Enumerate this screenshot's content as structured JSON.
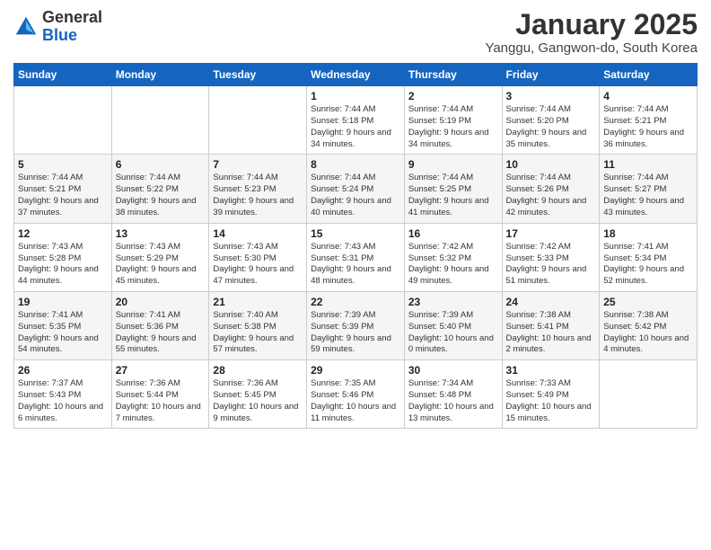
{
  "header": {
    "logo_general": "General",
    "logo_blue": "Blue",
    "month": "January 2025",
    "location": "Yanggu, Gangwon-do, South Korea"
  },
  "weekdays": [
    "Sunday",
    "Monday",
    "Tuesday",
    "Wednesday",
    "Thursday",
    "Friday",
    "Saturday"
  ],
  "weeks": [
    [
      {
        "day": "",
        "detail": ""
      },
      {
        "day": "",
        "detail": ""
      },
      {
        "day": "",
        "detail": ""
      },
      {
        "day": "1",
        "detail": "Sunrise: 7:44 AM\nSunset: 5:18 PM\nDaylight: 9 hours and 34 minutes."
      },
      {
        "day": "2",
        "detail": "Sunrise: 7:44 AM\nSunset: 5:19 PM\nDaylight: 9 hours and 34 minutes."
      },
      {
        "day": "3",
        "detail": "Sunrise: 7:44 AM\nSunset: 5:20 PM\nDaylight: 9 hours and 35 minutes."
      },
      {
        "day": "4",
        "detail": "Sunrise: 7:44 AM\nSunset: 5:21 PM\nDaylight: 9 hours and 36 minutes."
      }
    ],
    [
      {
        "day": "5",
        "detail": "Sunrise: 7:44 AM\nSunset: 5:21 PM\nDaylight: 9 hours and 37 minutes."
      },
      {
        "day": "6",
        "detail": "Sunrise: 7:44 AM\nSunset: 5:22 PM\nDaylight: 9 hours and 38 minutes."
      },
      {
        "day": "7",
        "detail": "Sunrise: 7:44 AM\nSunset: 5:23 PM\nDaylight: 9 hours and 39 minutes."
      },
      {
        "day": "8",
        "detail": "Sunrise: 7:44 AM\nSunset: 5:24 PM\nDaylight: 9 hours and 40 minutes."
      },
      {
        "day": "9",
        "detail": "Sunrise: 7:44 AM\nSunset: 5:25 PM\nDaylight: 9 hours and 41 minutes."
      },
      {
        "day": "10",
        "detail": "Sunrise: 7:44 AM\nSunset: 5:26 PM\nDaylight: 9 hours and 42 minutes."
      },
      {
        "day": "11",
        "detail": "Sunrise: 7:44 AM\nSunset: 5:27 PM\nDaylight: 9 hours and 43 minutes."
      }
    ],
    [
      {
        "day": "12",
        "detail": "Sunrise: 7:43 AM\nSunset: 5:28 PM\nDaylight: 9 hours and 44 minutes."
      },
      {
        "day": "13",
        "detail": "Sunrise: 7:43 AM\nSunset: 5:29 PM\nDaylight: 9 hours and 45 minutes."
      },
      {
        "day": "14",
        "detail": "Sunrise: 7:43 AM\nSunset: 5:30 PM\nDaylight: 9 hours and 47 minutes."
      },
      {
        "day": "15",
        "detail": "Sunrise: 7:43 AM\nSunset: 5:31 PM\nDaylight: 9 hours and 48 minutes."
      },
      {
        "day": "16",
        "detail": "Sunrise: 7:42 AM\nSunset: 5:32 PM\nDaylight: 9 hours and 49 minutes."
      },
      {
        "day": "17",
        "detail": "Sunrise: 7:42 AM\nSunset: 5:33 PM\nDaylight: 9 hours and 51 minutes."
      },
      {
        "day": "18",
        "detail": "Sunrise: 7:41 AM\nSunset: 5:34 PM\nDaylight: 9 hours and 52 minutes."
      }
    ],
    [
      {
        "day": "19",
        "detail": "Sunrise: 7:41 AM\nSunset: 5:35 PM\nDaylight: 9 hours and 54 minutes."
      },
      {
        "day": "20",
        "detail": "Sunrise: 7:41 AM\nSunset: 5:36 PM\nDaylight: 9 hours and 55 minutes."
      },
      {
        "day": "21",
        "detail": "Sunrise: 7:40 AM\nSunset: 5:38 PM\nDaylight: 9 hours and 57 minutes."
      },
      {
        "day": "22",
        "detail": "Sunrise: 7:39 AM\nSunset: 5:39 PM\nDaylight: 9 hours and 59 minutes."
      },
      {
        "day": "23",
        "detail": "Sunrise: 7:39 AM\nSunset: 5:40 PM\nDaylight: 10 hours and 0 minutes."
      },
      {
        "day": "24",
        "detail": "Sunrise: 7:38 AM\nSunset: 5:41 PM\nDaylight: 10 hours and 2 minutes."
      },
      {
        "day": "25",
        "detail": "Sunrise: 7:38 AM\nSunset: 5:42 PM\nDaylight: 10 hours and 4 minutes."
      }
    ],
    [
      {
        "day": "26",
        "detail": "Sunrise: 7:37 AM\nSunset: 5:43 PM\nDaylight: 10 hours and 6 minutes."
      },
      {
        "day": "27",
        "detail": "Sunrise: 7:36 AM\nSunset: 5:44 PM\nDaylight: 10 hours and 7 minutes."
      },
      {
        "day": "28",
        "detail": "Sunrise: 7:36 AM\nSunset: 5:45 PM\nDaylight: 10 hours and 9 minutes."
      },
      {
        "day": "29",
        "detail": "Sunrise: 7:35 AM\nSunset: 5:46 PM\nDaylight: 10 hours and 11 minutes."
      },
      {
        "day": "30",
        "detail": "Sunrise: 7:34 AM\nSunset: 5:48 PM\nDaylight: 10 hours and 13 minutes."
      },
      {
        "day": "31",
        "detail": "Sunrise: 7:33 AM\nSunset: 5:49 PM\nDaylight: 10 hours and 15 minutes."
      },
      {
        "day": "",
        "detail": ""
      }
    ]
  ]
}
